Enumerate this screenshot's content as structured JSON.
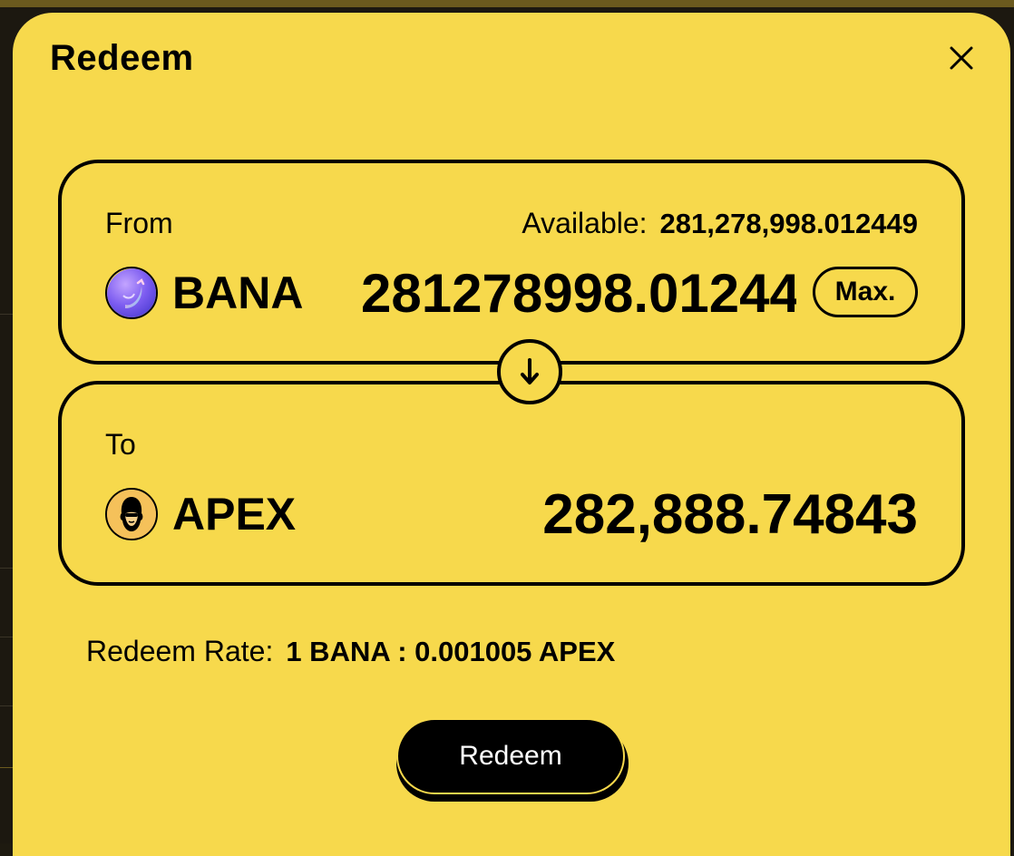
{
  "modal": {
    "title": "Redeem"
  },
  "from": {
    "label": "From",
    "available_label": "Available:",
    "available_value": "281,278,998.012449",
    "token": {
      "symbol": "BANA",
      "icon": "banana-token-icon"
    },
    "amount": "281278998.012449",
    "max_label": "Max."
  },
  "to": {
    "label": "To",
    "token": {
      "symbol": "APEX",
      "icon": "ape-token-icon"
    },
    "amount": "282,888.74843"
  },
  "rate": {
    "label": "Redeem Rate:",
    "value": "1 BANA : 0.001005 APEX"
  },
  "actions": {
    "redeem_label": "Redeem"
  },
  "colors": {
    "modal_background": "#f7d94c",
    "border": "#000000",
    "button_background": "#000000",
    "button_text": "#ffffff"
  }
}
